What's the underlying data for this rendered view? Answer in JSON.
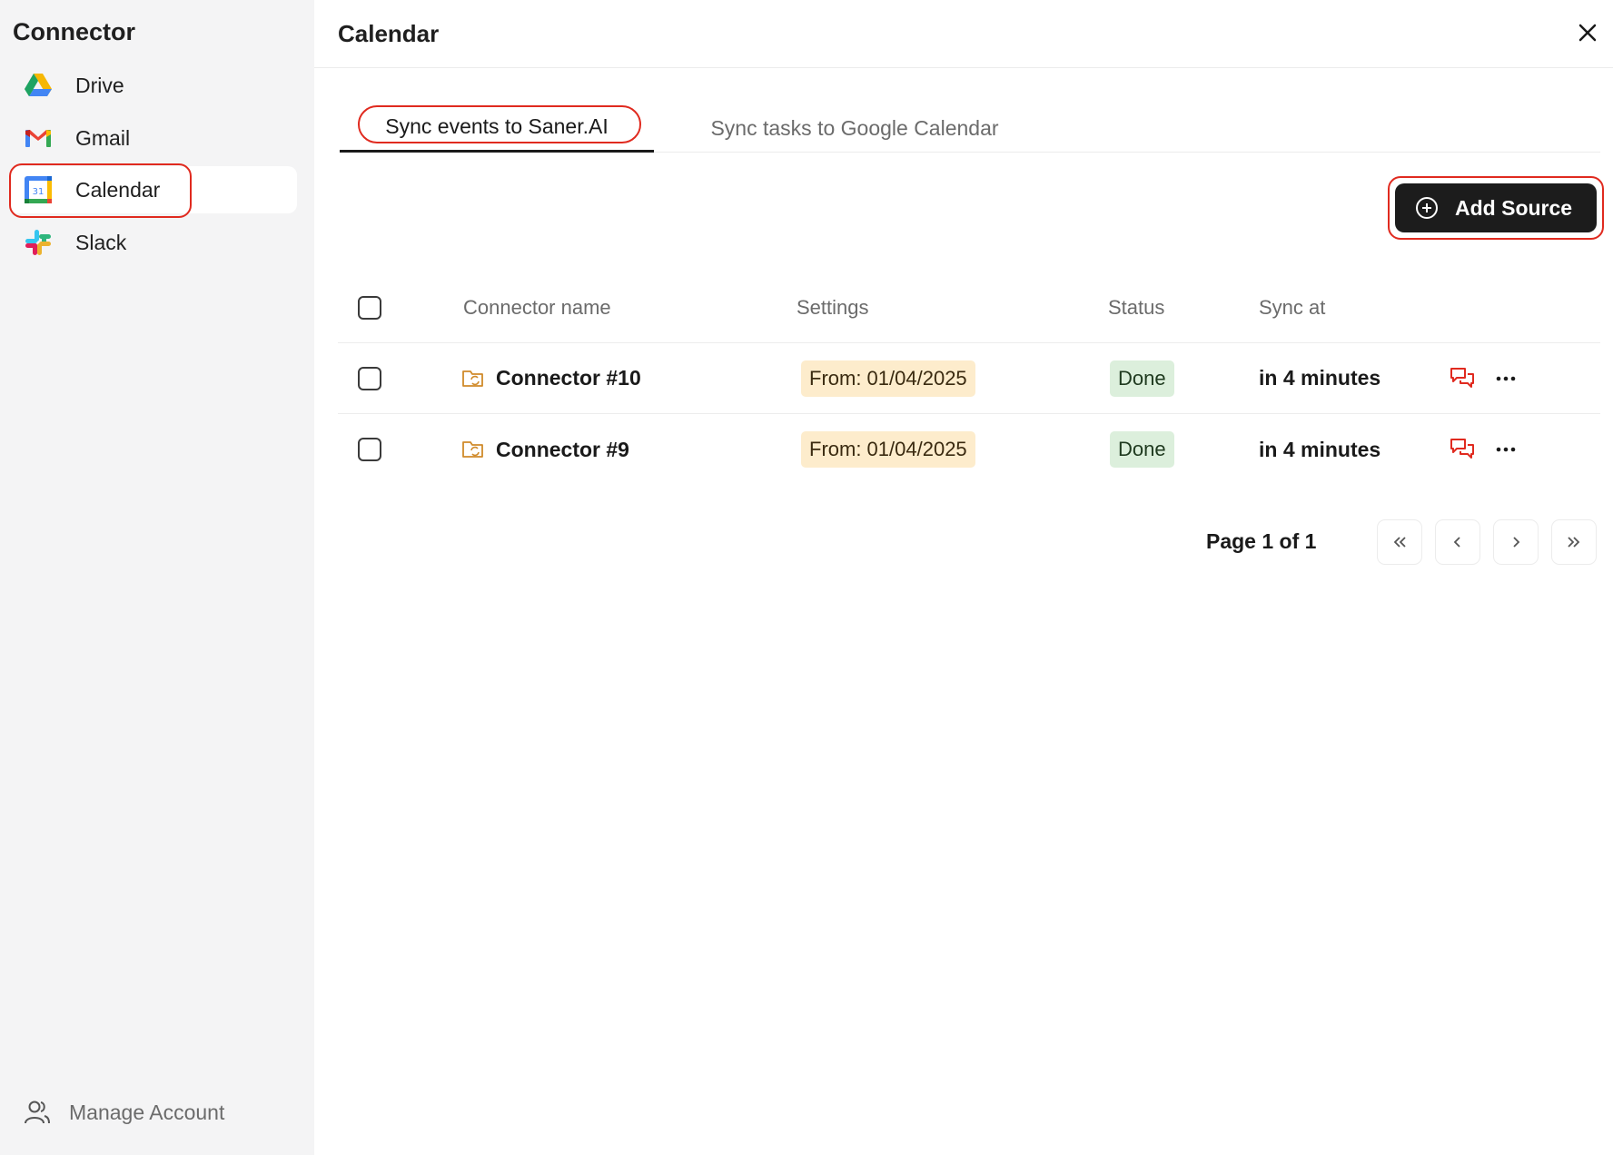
{
  "sidebar": {
    "title": "Connector",
    "items": [
      {
        "label": "Drive",
        "icon": "google-drive-icon"
      },
      {
        "label": "Gmail",
        "icon": "gmail-icon"
      },
      {
        "label": "Calendar",
        "icon": "google-calendar-icon",
        "active": true,
        "calendar_day": "31"
      },
      {
        "label": "Slack",
        "icon": "slack-icon"
      }
    ],
    "manage_account": "Manage Account"
  },
  "header": {
    "title": "Calendar"
  },
  "tabs": [
    {
      "label": "Sync events to Saner.AI",
      "active": true
    },
    {
      "label": "Sync tasks to Google Calendar",
      "active": false
    }
  ],
  "toolbar": {
    "add_source_label": "Add Source"
  },
  "table": {
    "columns": [
      "Connector name",
      "Settings",
      "Status",
      "Sync at"
    ],
    "rows": [
      {
        "name": "Connector #10",
        "settings": "From: 01/04/2025",
        "status": "Done",
        "sync_at": "in 4 minutes"
      },
      {
        "name": "Connector #9",
        "settings": "From: 01/04/2025",
        "status": "Done",
        "sync_at": "in 4 minutes"
      }
    ]
  },
  "pagination": {
    "text": "Page 1 of 1"
  },
  "colors": {
    "highlight": "#e02a1f",
    "settings_badge": "#fdeccc",
    "done_badge": "#dcefdc",
    "primary_button": "#1c1c1c",
    "folder_icon": "#d08a2a"
  }
}
